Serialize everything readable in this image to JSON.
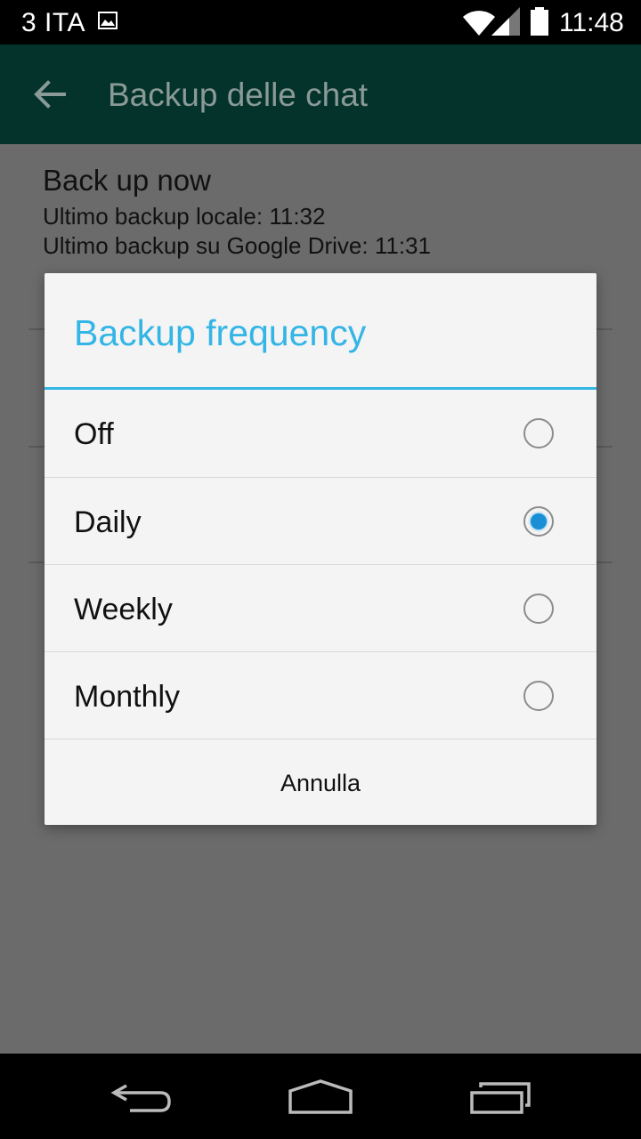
{
  "status_bar": {
    "carrier": "3 ITA",
    "time": "11:48",
    "icons": [
      "image-notification-icon",
      "wifi-icon",
      "signal-icon",
      "battery-icon"
    ]
  },
  "app_bar": {
    "title": "Backup delle chat",
    "back_icon": "arrow-left-icon"
  },
  "background": {
    "title": "Back up now",
    "local_backup": "Ultimo backup locale: 11:32",
    "drive_backup": "Ultimo backup su Google Drive: 11:31"
  },
  "dialog": {
    "title": "Backup frequency",
    "accent_color": "#33b5e5",
    "options": [
      {
        "label": "Off",
        "selected": false
      },
      {
        "label": "Daily",
        "selected": true
      },
      {
        "label": "Weekly",
        "selected": false
      },
      {
        "label": "Monthly",
        "selected": false
      }
    ],
    "cancel_label": "Annulla"
  },
  "nav_bar": {
    "icons": [
      "back-icon",
      "home-icon",
      "recents-icon"
    ]
  }
}
